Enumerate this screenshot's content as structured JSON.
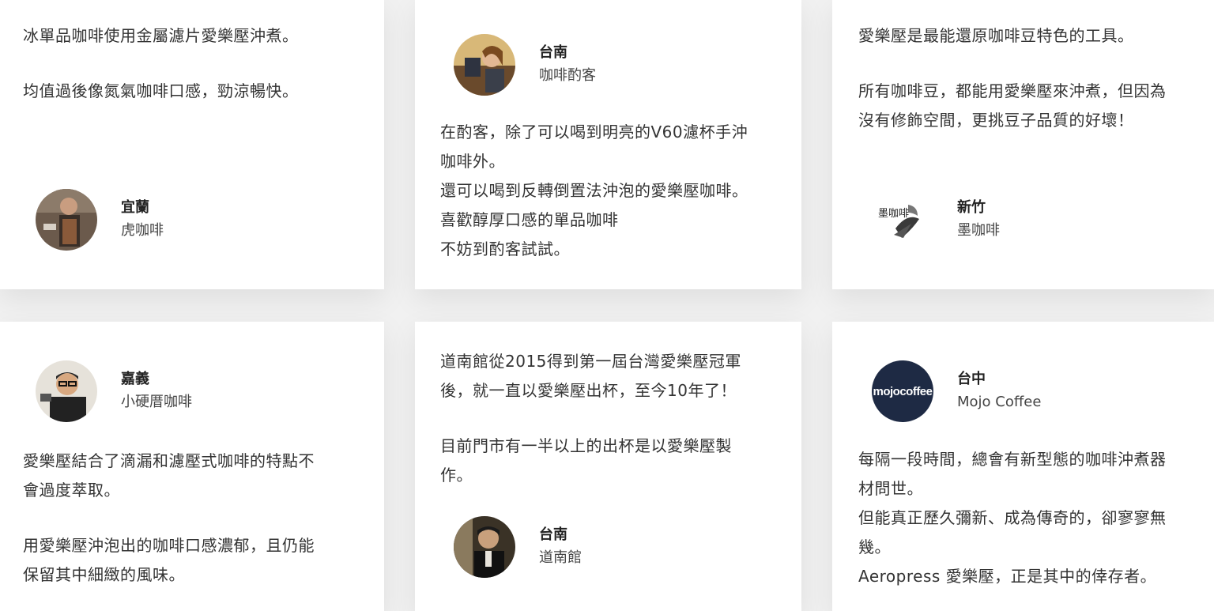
{
  "cards": [
    {
      "paragraphs": [
        "冰單品咖啡使用金屬濾片愛樂壓沖煮。",
        "均值過後像氮氣咖啡口感，勁涼暢快。"
      ],
      "author": {
        "city": "宜蘭",
        "shop": "虎咖啡",
        "avatar": "barista-photo"
      }
    },
    {
      "author": {
        "city": "台南",
        "shop": "咖啡酌客",
        "avatar": "barista-woman-photo"
      },
      "lines": [
        "在酌客，除了可以喝到明亮的V60濾杯手沖",
        "咖啡外。",
        "還可以喝到反轉倒置法沖泡的愛樂壓咖啡。",
        "喜歡醇厚口感的單品咖啡",
        "不妨到酌客試試。"
      ]
    },
    {
      "paragraphs": [
        "愛樂壓是最能還原咖啡豆特色的工具。",
        "所有咖啡豆，都能用愛樂壓來沖煮，但因為沒有修飾空間，更挑豆子品質的好壞！"
      ],
      "lines_p2": [
        "所有咖啡豆，都能用愛樂壓來沖煮，但因為",
        "沒有修飾空間，更挑豆子品質的好壞！"
      ],
      "author": {
        "city": "新竹",
        "shop": "墨咖啡",
        "avatar": "ink-coffee-logo",
        "logo_text": "墨咖啡"
      }
    },
    {
      "author": {
        "city": "嘉義",
        "shop": "小硬厝咖啡",
        "avatar": "barista-glasses-photo"
      },
      "lines_p1": [
        "愛樂壓結合了滴漏和濾壓式咖啡的特點不",
        "會過度萃取。"
      ],
      "lines_p2": [
        "用愛樂壓沖泡出的咖啡口感濃郁，且仍能",
        "保留其中細緻的風味。"
      ]
    },
    {
      "lines_p1": [
        "道南館從2015得到第一屆台灣愛樂壓冠軍",
        "後，就一直以愛樂壓出杯，至今10年了！"
      ],
      "lines_p2": [
        "目前門市有一半以上的出杯是以愛樂壓製",
        "作。"
      ],
      "author": {
        "city": "台南",
        "shop": "道南館",
        "avatar": "owner-photo"
      }
    },
    {
      "author": {
        "city": "台中",
        "shop": "Mojo Coffee",
        "avatar": "mojo-coffee-logo",
        "logo_text": "mojocoffee"
      },
      "lines": [
        "每隔一段時間，總會有新型態的咖啡沖煮器",
        "材問世。",
        "但能真正歷久彌新、成為傳奇的，卻寥寥無",
        "幾。",
        "Aeropress 愛樂壓，正是其中的倖存者。"
      ]
    }
  ],
  "colors": {
    "text": "#333333",
    "name": "#222222",
    "background": "#f1f1f1",
    "card": "#ffffff",
    "mojo_navy": "#1e2a44"
  }
}
